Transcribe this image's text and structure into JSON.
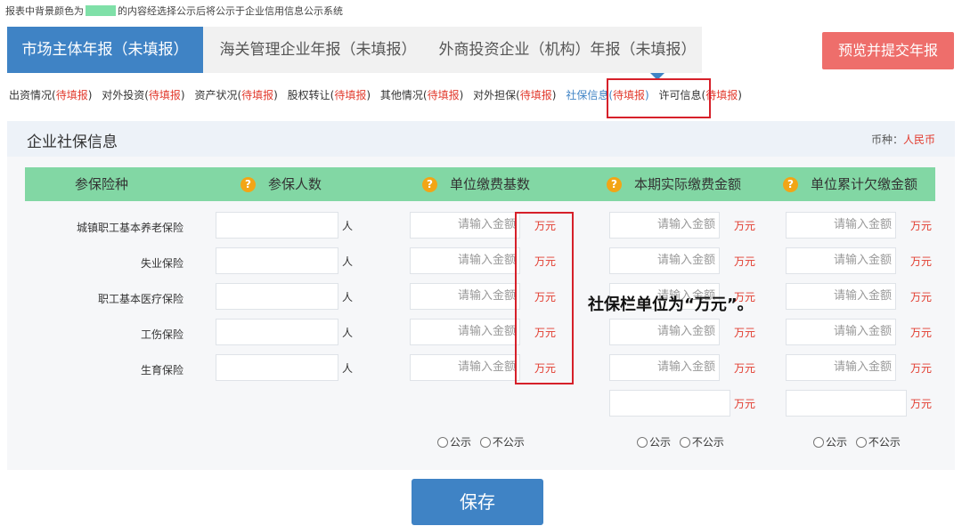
{
  "notice": {
    "prefix": "报表中背景颜色为",
    "suffix": "的内容经选择公示后将公示于企业信用信息公示系统"
  },
  "tabs": [
    {
      "label": "市场主体年报（未填报）"
    },
    {
      "label": "海关管理企业年报（未填报）"
    },
    {
      "label": "外商投资企业（机构）年报（未填报）"
    }
  ],
  "submit_label": "预览并提交年报",
  "subnav": [
    {
      "label": "出资情况(",
      "status": "待填报",
      "close": ")"
    },
    {
      "label": "对外投资(",
      "status": "待填报",
      "close": ")"
    },
    {
      "label": "资产状况(",
      "status": "待填报",
      "close": ")"
    },
    {
      "label": "股权转让(",
      "status": "待填报",
      "close": ")"
    },
    {
      "label": "其他情况(",
      "status": "待填报",
      "close": ")"
    },
    {
      "label": "对外担保(",
      "status": "待填报",
      "close": ")"
    },
    {
      "label": "社保信息(",
      "status": "待填报",
      "close": ")"
    },
    {
      "label": "许可信息(",
      "status": "待填报",
      "close": ")"
    }
  ],
  "panel": {
    "title": "企业社保信息",
    "currency_label": "币种：",
    "currency_value": "人民币"
  },
  "table": {
    "headers": [
      "参保险种",
      "参保人数",
      "单位缴费基数",
      "本期实际缴费金额",
      "单位累计欠缴金额"
    ],
    "rows": [
      {
        "label": "城镇职工基本养老保险"
      },
      {
        "label": "失业保险"
      },
      {
        "label": "职工基本医疗保险"
      },
      {
        "label": "工伤保险"
      },
      {
        "label": "生育保险"
      }
    ],
    "placeholder": "请输入金额",
    "unit_person": "人",
    "unit_money": "万元",
    "radio_public": "公示",
    "radio_private": "不公示"
  },
  "callout": "社保栏单位为“万元”。",
  "save_label": "保存",
  "colors": {
    "accent": "#3f83c5",
    "header_green": "#82d7a4",
    "danger": "#ee6e6b",
    "status_red": "#e23b2e"
  }
}
